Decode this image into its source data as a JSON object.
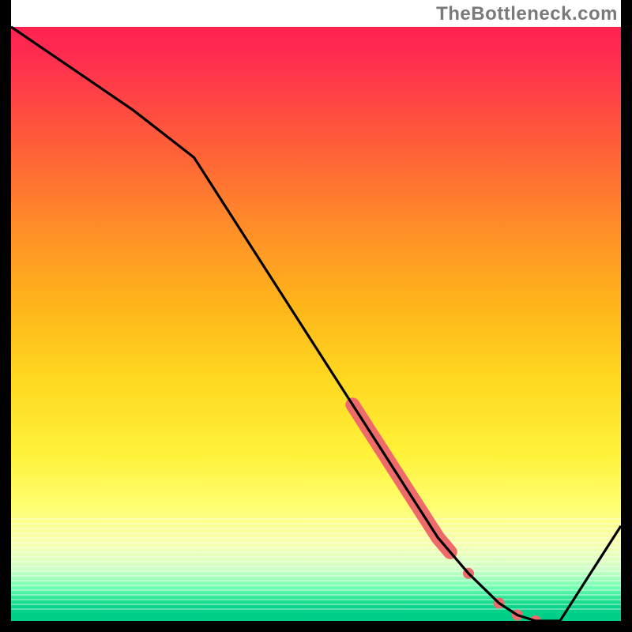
{
  "attribution": "TheBottleneck.com",
  "chart_data": {
    "type": "line",
    "title": "",
    "xlabel": "",
    "ylabel": "",
    "xlim": [
      0,
      100
    ],
    "ylim": [
      0,
      100
    ],
    "background_gradient": {
      "top": "#ff1a52",
      "middle": "#fff23a",
      "bottom": "#00cc88",
      "meaning": "red = high bottleneck, green = low bottleneck"
    },
    "series": [
      {
        "name": "bottleneck-curve",
        "color": "#000000",
        "x": [
          0,
          10,
          20,
          30,
          40,
          50,
          60,
          65,
          70,
          75,
          80,
          83,
          86,
          90,
          95,
          100
        ],
        "y": [
          100,
          93,
          86,
          78,
          62,
          46,
          30,
          22,
          14,
          8,
          3,
          1,
          0,
          0,
          8,
          16
        ]
      }
    ],
    "highlight_band": {
      "name": "highlighted-range",
      "color": "#ef6b6b",
      "description": "thick coral segment along descending part of curve",
      "x_range": [
        56,
        72
      ],
      "y_at_start": 36,
      "y_at_end": 12,
      "extra_dots": [
        {
          "x": 75,
          "y": 8
        },
        {
          "x": 80,
          "y": 3
        },
        {
          "x": 83,
          "y": 1
        },
        {
          "x": 86,
          "y": 0
        }
      ]
    }
  }
}
